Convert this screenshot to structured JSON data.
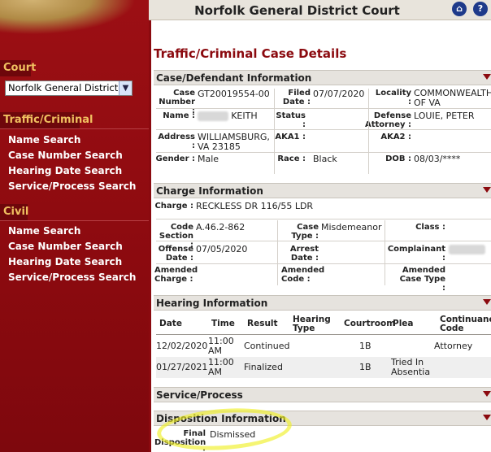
{
  "header": {
    "title": "Norfolk General District Court"
  },
  "sidebar": {
    "court_label": "Court",
    "court_select_value": "Norfolk General District C",
    "traffic_heading": "Traffic/Criminal",
    "traffic_links": [
      "Name Search",
      "Case Number Search",
      "Hearing Date Search",
      "Service/Process Search"
    ],
    "civil_heading": "Civil",
    "civil_links": [
      "Name Search",
      "Case Number Search",
      "Hearing Date Search",
      "Service/Process Search"
    ]
  },
  "page_title": "Traffic/Criminal Case Details",
  "case_info": {
    "heading": "Case/Defendant Information",
    "case_number_label": "Case Number :",
    "case_number": "GT20019554-00",
    "filed_label": "Filed Date :",
    "filed": "07/07/2020",
    "locality_label": "Locality :",
    "locality": "COMMONWEALTH OF VA",
    "name_label": "Name :",
    "name": "KEITH",
    "status_label": "Status :",
    "status": "",
    "defense_label": "Defense Attorney :",
    "defense": "LOUIE, PETER",
    "address_label": "Address :",
    "address": "WILLIAMSBURG, VA 23185",
    "aka1_label": "AKA1 :",
    "aka2_label": "AKA2 :",
    "gender_label": "Gender :",
    "gender": "Male",
    "race_label": "Race :",
    "race": "Black",
    "dob_label": "DOB :",
    "dob": "08/03/****"
  },
  "charge_info": {
    "heading": "Charge Information",
    "charge_label": "Charge :",
    "charge": "RECKLESS DR 116/55 LDR",
    "code_label": "Code Section :",
    "code": "A.46.2-862",
    "case_type_label": "Case Type :",
    "case_type": "Misdemeanor",
    "class_label": "Class :",
    "offense_label": "Offense Date :",
    "offense": "07/05/2020",
    "arrest_label": "Arrest Date :",
    "complainant_label": "Complainant :",
    "amended_charge_label": "Amended Charge :",
    "amended_code_label": "Amended Code :",
    "amended_type_label": "Amended Case Type :"
  },
  "hearing_info": {
    "heading": "Hearing Information",
    "columns": [
      "Date",
      "Time",
      "Result",
      "Hearing Type",
      "Courtroom",
      "Plea",
      "Continuance Code"
    ],
    "rows": [
      {
        "date": "12/02/2020",
        "time": "11:00 AM",
        "result": "Continued",
        "type": "",
        "courtroom": "1B",
        "plea": "",
        "continuance": "Attorney"
      },
      {
        "date": "01/27/2021",
        "time": "11:00 AM",
        "result": "Finalized",
        "type": "",
        "courtroom": "1B",
        "plea": "Tried In Absentia",
        "continuance": ""
      }
    ]
  },
  "service_info": {
    "heading": "Service/Process"
  },
  "disposition_info": {
    "heading": "Disposition Information",
    "final_label": "Final Disposition :",
    "final": "Dismissed"
  },
  "colors": {
    "brand_red": "#8b0a0f",
    "section_bg": "#e6e3de",
    "link_gold": "#f0c060"
  }
}
